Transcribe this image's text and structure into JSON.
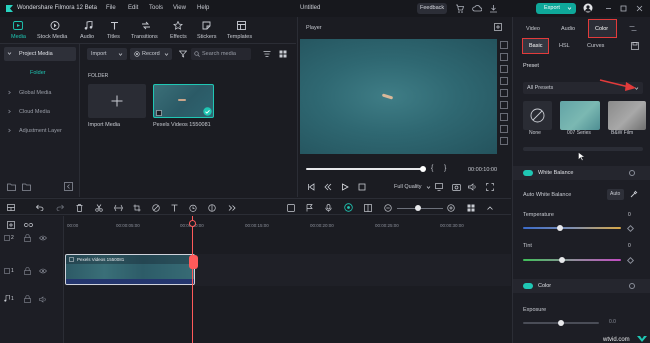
{
  "titlebar": {
    "app_name": "Wondershare Filmora 12 Beta",
    "menus": [
      "File",
      "Edit",
      "Tools",
      "View",
      "Help"
    ],
    "project_title": "Untitled",
    "feedback": "Feedback",
    "export": "Export"
  },
  "toolbar": {
    "tabs": [
      "Media",
      "Stock Media",
      "Audio",
      "Titles",
      "Transitions",
      "Effects",
      "Stickers",
      "Templates"
    ]
  },
  "media_sidebar": {
    "project_media": "Project Media",
    "folder": "Folder",
    "items": [
      "Global Media",
      "Cloud Media",
      "Adjustment Layer"
    ]
  },
  "media_panel": {
    "import": "Import",
    "record": "Record",
    "search_placeholder": "Search media",
    "folder_header": "FOLDER",
    "import_media_label": "Import Media",
    "clip_label": "Pexels Videos 1550081"
  },
  "player": {
    "title": "Player",
    "time": "00:00:10:00",
    "quality": "Full Quality"
  },
  "timeline": {
    "ruler": [
      "00:00",
      "00:00:05:00",
      "00:00:10:00",
      "00:00:15:00",
      "00:00:20:00",
      "00:00:25:00",
      "00:00:30:00"
    ],
    "tracks": [
      "2",
      "1",
      "1"
    ],
    "clip_label": "Pexels Videos 1550081"
  },
  "right_panel": {
    "top_tabs": [
      "Video",
      "Audio",
      "Color"
    ],
    "active_top_tab": "Color",
    "sub_tabs": [
      "Basic",
      "HSL",
      "Curves"
    ],
    "active_sub_tab": "Basic",
    "preset_header": "Preset",
    "preset_select": "All Presets",
    "preset_items": [
      "None",
      "007 Series",
      "B&W Film"
    ],
    "white_balance": "White Balance",
    "auto_white_balance": "Auto White Balance",
    "auto_button": "Auto",
    "temperature": "Temperature",
    "temperature_value": "0",
    "tint": "Tint",
    "tint_value": "0",
    "color": "Color",
    "exposure": "Exposure",
    "exposure_value": "0.0"
  },
  "watermark": "wtvid.com",
  "colors": {
    "accent": "#1fc7b4",
    "export": "#0fa89a",
    "highlight": "#e23b3b",
    "playhead": "#ff5a5a"
  }
}
